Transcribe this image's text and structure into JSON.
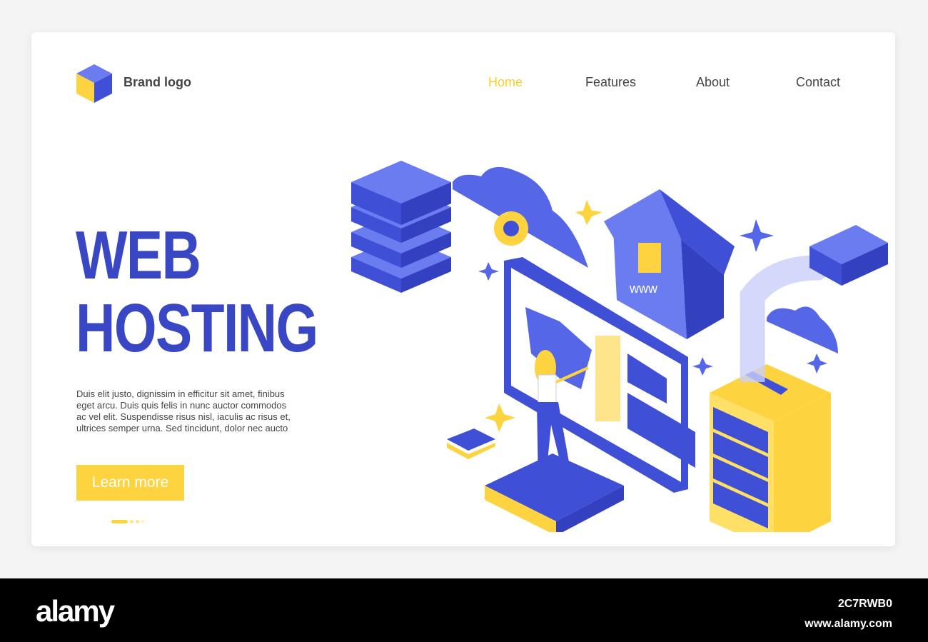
{
  "header": {
    "brand": "Brand logo",
    "nav": [
      {
        "label": "Home",
        "active": true
      },
      {
        "label": "Features"
      },
      {
        "label": "About"
      },
      {
        "label": "Contact"
      }
    ]
  },
  "hero": {
    "title_line1": "WEB",
    "title_line2": "HOSTING",
    "description": "Duis elit justo, dignissim in efficitur sit amet, finibus eget arcu. Duis quis felis in nunc auctor commodos ac vel elit. Suspendisse risus nisl, iaculis ac risus et, ultrices semper urna. Sed tincidunt, dolor nec aucto",
    "cta": "Learn more",
    "carousel": {
      "count": 4,
      "active": 1
    }
  },
  "illustration": {
    "house_label": "www"
  },
  "colors": {
    "primary": "#3a47c4",
    "accent": "#fdd43f",
    "light_blue": "#6a7cf0"
  },
  "footer": {
    "logo": "alamy",
    "image_code": "2C7RWB0",
    "site": "www.alamy.com"
  }
}
